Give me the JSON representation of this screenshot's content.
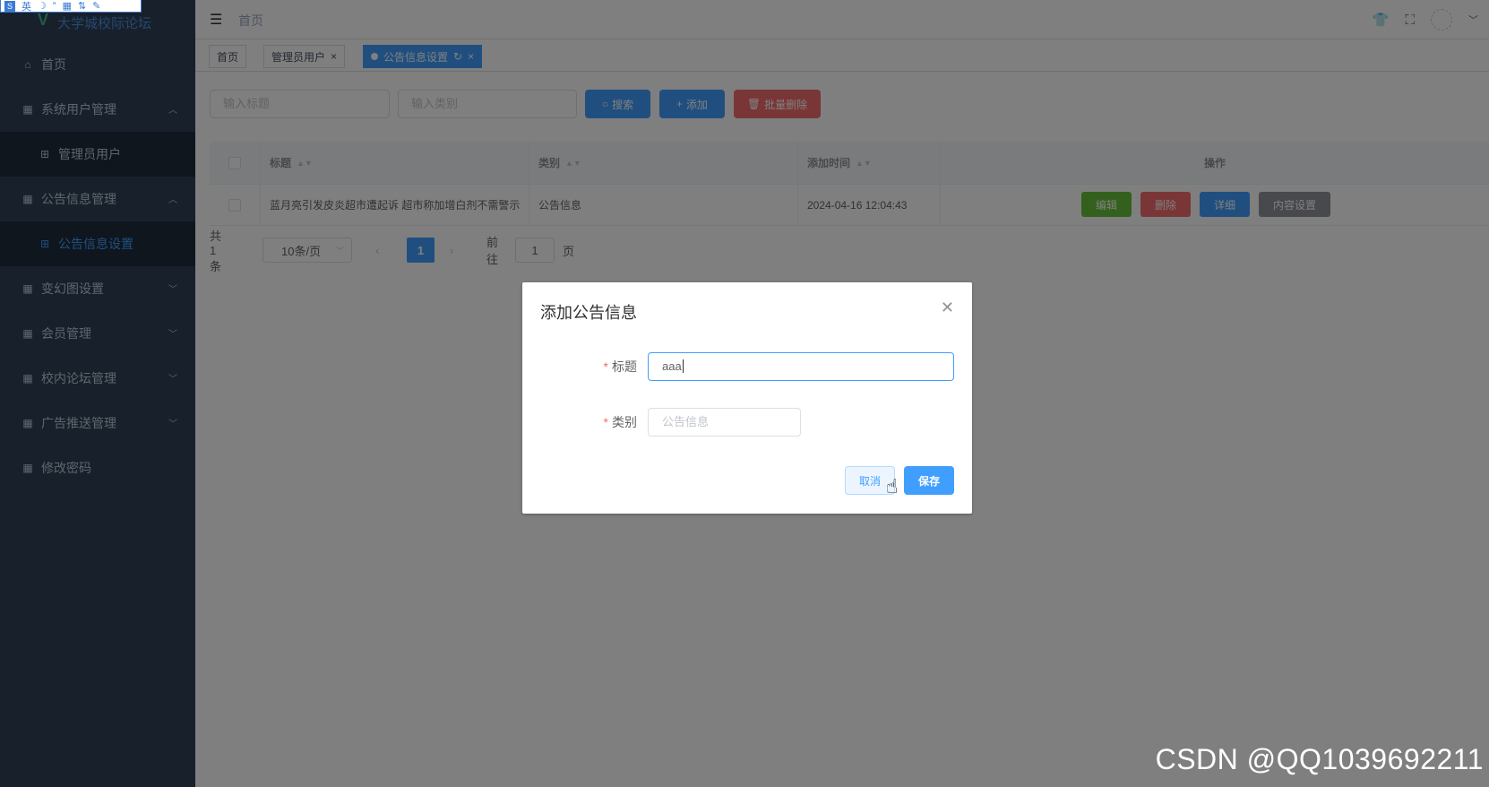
{
  "ime_bar": [
    "英",
    "☽",
    "”",
    "▦",
    "⇅",
    "✎"
  ],
  "sidebar": {
    "logo": "大学城校际论坛",
    "items": [
      {
        "label": "首页",
        "icon": "home-icon"
      },
      {
        "label": "系统用户管理",
        "icon": "grid-icon",
        "expanded": true
      },
      {
        "label": "管理员用户",
        "icon": "apps-icon",
        "sub": true
      },
      {
        "label": "公告信息管理",
        "icon": "grid-icon",
        "expanded": true
      },
      {
        "label": "公告信息设置",
        "icon": "apps-icon",
        "sub": true,
        "active": true
      },
      {
        "label": "变幻图设置",
        "icon": "grid-icon"
      },
      {
        "label": "会员管理",
        "icon": "grid-icon"
      },
      {
        "label": "校内论坛管理",
        "icon": "grid-icon"
      },
      {
        "label": "广告推送管理",
        "icon": "grid-icon"
      },
      {
        "label": "修改密码",
        "icon": "grid-icon"
      }
    ]
  },
  "navbar": {
    "breadcrumb": "首页"
  },
  "tags": [
    {
      "label": "首页"
    },
    {
      "label": "管理员用户"
    },
    {
      "label": "公告信息设置",
      "active": true
    }
  ],
  "search": {
    "title_placeholder": "输入标题",
    "category_placeholder": "输入类别",
    "search_btn": "搜索",
    "add_btn": "添加",
    "batch_delete_btn": "批量删除"
  },
  "table": {
    "headers": [
      "标题",
      "类别",
      "添加时间",
      "操作"
    ],
    "rows": [
      {
        "title": "蓝月亮引发皮炎超市遭起诉 超市称加增白剂不需警示",
        "category": "公告信息",
        "time": "2024-04-16 12:04:43"
      }
    ],
    "actions": [
      "编辑",
      "删除",
      "详细",
      "内容设置"
    ]
  },
  "pagination": {
    "total": "共 1 条",
    "page_size": "10条/页",
    "current": "1",
    "goto_label": "前往",
    "goto_value": "1",
    "page_suffix": "页"
  },
  "dialog": {
    "title": "添加公告信息",
    "fields": [
      {
        "label": "标题",
        "value": "aaa"
      },
      {
        "label": "类别",
        "placeholder": "公告信息"
      }
    ],
    "cancel": "取消",
    "save": "保存"
  },
  "watermark": "CSDN @QQ1039692211",
  "colors": {
    "primary": "#409eff",
    "danger": "#f56c6c",
    "success": "#67c23a",
    "info": "#909399",
    "sidebar": "#304156"
  }
}
